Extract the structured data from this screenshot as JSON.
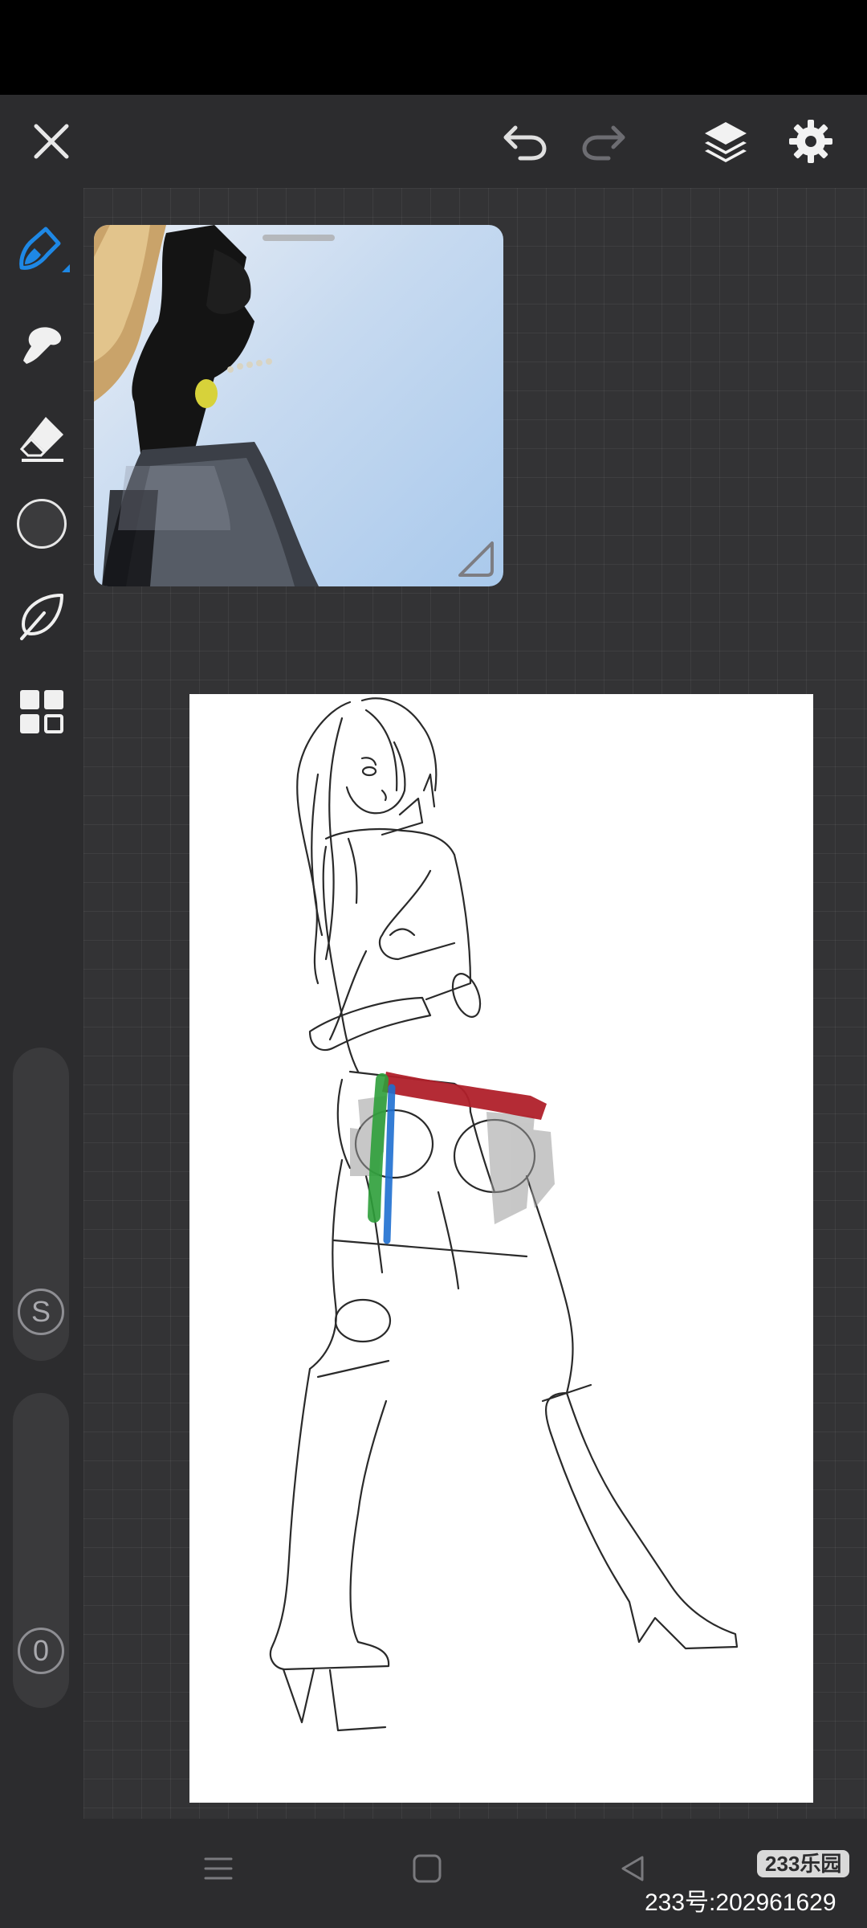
{
  "toolbar": {
    "close_icon": "close-icon",
    "undo_icon": "undo-icon",
    "redo_icon": "redo-icon",
    "layers_icon": "layers-icon",
    "settings_icon": "gear-icon"
  },
  "tools": [
    {
      "name": "brush",
      "icon": "brush-icon",
      "active": true
    },
    {
      "name": "smudge",
      "icon": "smudge-icon"
    },
    {
      "name": "eraser",
      "icon": "eraser-icon"
    },
    {
      "name": "color",
      "icon": "color-swatch",
      "color": "#3b3b3d"
    },
    {
      "name": "lasso",
      "icon": "lasso-icon"
    },
    {
      "name": "more",
      "icon": "grid-icon"
    }
  ],
  "sliders": {
    "size_label": "S",
    "opacity_label": "0"
  },
  "reference": {
    "title": ""
  },
  "colors": {
    "accent": "#1e88e5",
    "background": "#2c2c2e",
    "sketch_red": "#b0202a",
    "sketch_green": "#2e9e3a",
    "sketch_blue": "#1e6fd0"
  },
  "nav": {
    "menu_icon": "menu-icon",
    "home_icon": "home-icon",
    "back_icon": "back-icon"
  },
  "watermark": {
    "badge": "233乐园",
    "id_text": "233号:202961629"
  }
}
